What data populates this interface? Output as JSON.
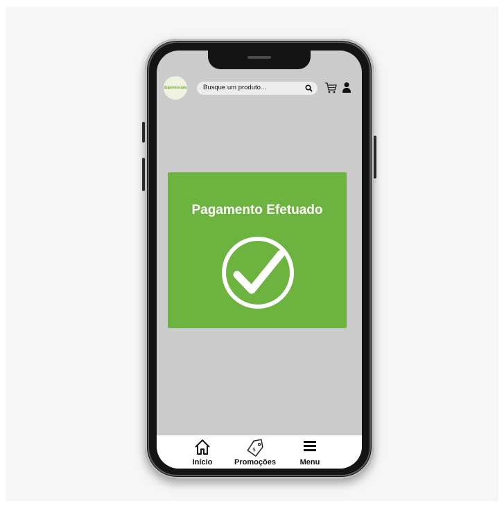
{
  "header": {
    "logo_text": "Supermercado",
    "search_placeholder": "Busque um produto...",
    "search_icon": "search-icon",
    "cart_icon": "cart-icon",
    "user_icon": "user-icon"
  },
  "confirmation": {
    "title": "Pagamento Efetuado",
    "icon": "check-circle-icon",
    "color": "#6cb33f"
  },
  "bottom_nav": {
    "items": [
      {
        "label": "Início",
        "icon": "home-icon"
      },
      {
        "label": "Promoções",
        "icon": "tag-icon"
      },
      {
        "label": "Menu",
        "icon": "menu-icon"
      }
    ]
  }
}
